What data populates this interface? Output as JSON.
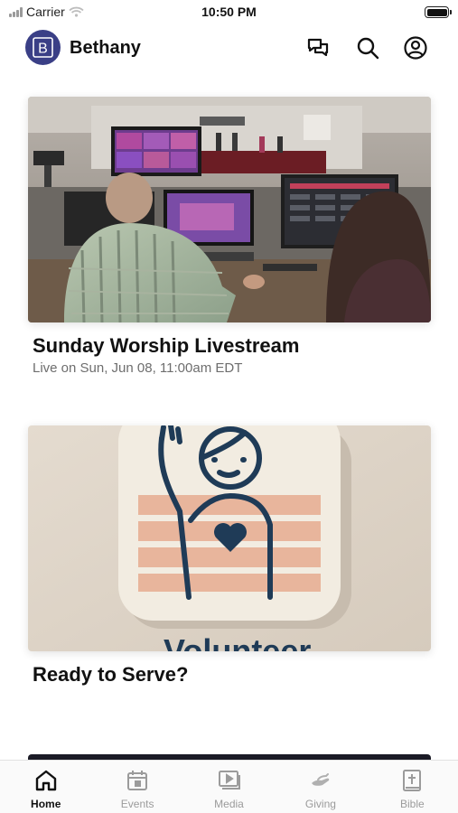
{
  "status_bar": {
    "carrier": "Carrier",
    "time": "10:50 PM"
  },
  "header": {
    "logo_letter": "B",
    "title": "Bethany",
    "icons": [
      "chat-icon",
      "search-icon",
      "profile-icon"
    ]
  },
  "cards": [
    {
      "title": "Sunday Worship Livestream",
      "subtitle": "Live on Sun, Jun 08, 11:00am EDT",
      "image": "livestream-control-room-photo"
    },
    {
      "title": "Ready to Serve?",
      "image": "volunteer-hand-raise-illustration",
      "image_text": "Volunteer"
    }
  ],
  "tabs": [
    {
      "label": "Home",
      "icon": "home-icon",
      "active": true
    },
    {
      "label": "Events",
      "icon": "calendar-icon",
      "active": false
    },
    {
      "label": "Media",
      "icon": "media-icon",
      "active": false
    },
    {
      "label": "Giving",
      "icon": "giving-icon",
      "active": false
    },
    {
      "label": "Bible",
      "icon": "bible-icon",
      "active": false
    }
  ],
  "colors": {
    "brand": "#3a3f86",
    "tab_active": "#111111",
    "tab_inactive": "#9b9b9b",
    "subtitle": "#6e6e6e"
  }
}
